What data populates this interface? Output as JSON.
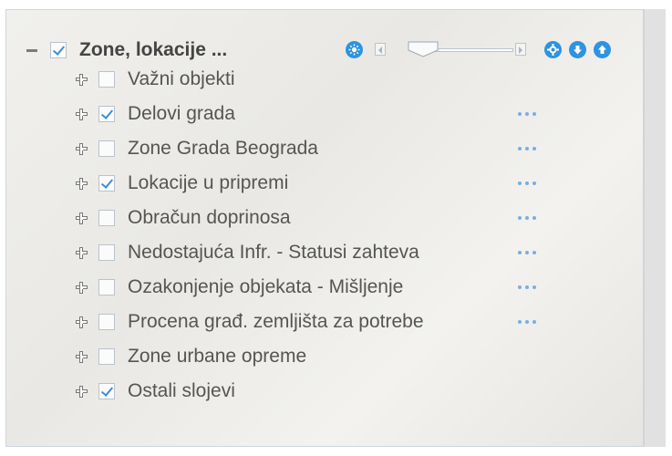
{
  "group": {
    "label": "Zone, lokacije ...",
    "checked": true
  },
  "layers": [
    {
      "label": "Važni objekti",
      "checked": false,
      "has_menu": false
    },
    {
      "label": "Delovi grada",
      "checked": true,
      "has_menu": true
    },
    {
      "label": "Zone Grada Beograda",
      "checked": false,
      "has_menu": true
    },
    {
      "label": "Lokacije u pripremi",
      "checked": true,
      "has_menu": true
    },
    {
      "label": "Obračun doprinosa",
      "checked": false,
      "has_menu": true
    },
    {
      "label": "Nedostajuća Infr. - Statusi zahteva",
      "checked": false,
      "has_menu": true
    },
    {
      "label": "Ozakonjenje objekata - Mišljenje",
      "checked": false,
      "has_menu": true
    },
    {
      "label": "Procena građ. zemljišta za potrebe",
      "checked": false,
      "has_menu": true
    },
    {
      "label": "Zone urbane opreme",
      "checked": false,
      "has_menu": false
    },
    {
      "label": "Ostali slojevi",
      "checked": true,
      "has_menu": false
    }
  ],
  "toolbar": {
    "icons": [
      "brightness-icon",
      "slider-left-icon",
      "opacity-slider",
      "slider-right-icon",
      "settings-icon",
      "move-down-icon",
      "move-up-icon"
    ],
    "opacity_fraction": 0.2
  },
  "colors": {
    "accent": "#2e93e0",
    "checkmark": "#3b8fd6",
    "menu_dots": "#79aee0"
  }
}
